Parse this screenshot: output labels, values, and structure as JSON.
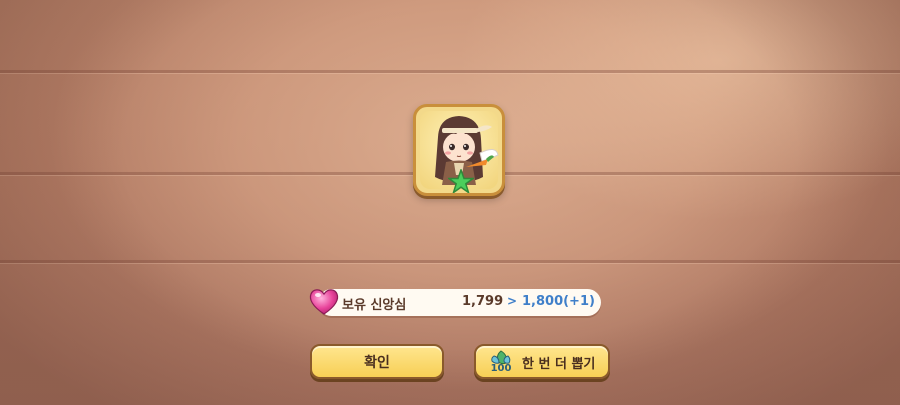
{
  "faith": {
    "label": "보유 신앙심",
    "current": "1,799",
    "arrow": ">",
    "next": "1,800(+1)",
    "icon": "heart-icon"
  },
  "buttons": {
    "confirm_label": "확인",
    "draw_again_label": "한 번 더 뽑기",
    "draw_cost": "100",
    "draw_cost_icon": "leaf-currency-icon"
  },
  "card": {
    "icon": "character-portrait",
    "badge_icon": "star-icon"
  },
  "colors": {
    "accent_blue": "#3f7fc9",
    "button_yellow": "#f7cf55",
    "heart_pink": "#e8439a"
  }
}
